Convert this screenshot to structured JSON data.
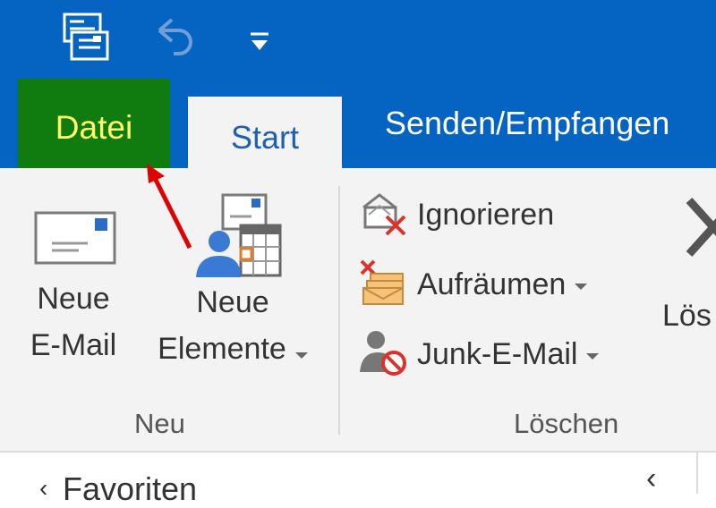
{
  "quick_access": {
    "icons": [
      "send-receive-icon",
      "undo-icon",
      "customize-quick-access-icon"
    ]
  },
  "tabs": {
    "file": "Datei",
    "home": "Start",
    "send_receive": "Senden/Empfangen"
  },
  "ribbon": {
    "group_new": {
      "label": "Neu",
      "new_email": [
        "Neue",
        "E-Mail"
      ],
      "new_items": [
        "Neue",
        "Elemente"
      ]
    },
    "group_delete": {
      "label": "Löschen",
      "ignore": "Ignorieren",
      "cleanup": "Aufräumen",
      "junk": "Junk-E-Mail",
      "delete_partial": "Lös"
    }
  },
  "nav": {
    "favorites_partial": "Favoriten"
  },
  "colors": {
    "title_blue": "#0563c1",
    "file_tab_green": "#107c10",
    "highlight_yellow": "#ffff00",
    "ribbon_bg": "#f3f3f3",
    "annotation_red": "#e00000"
  }
}
